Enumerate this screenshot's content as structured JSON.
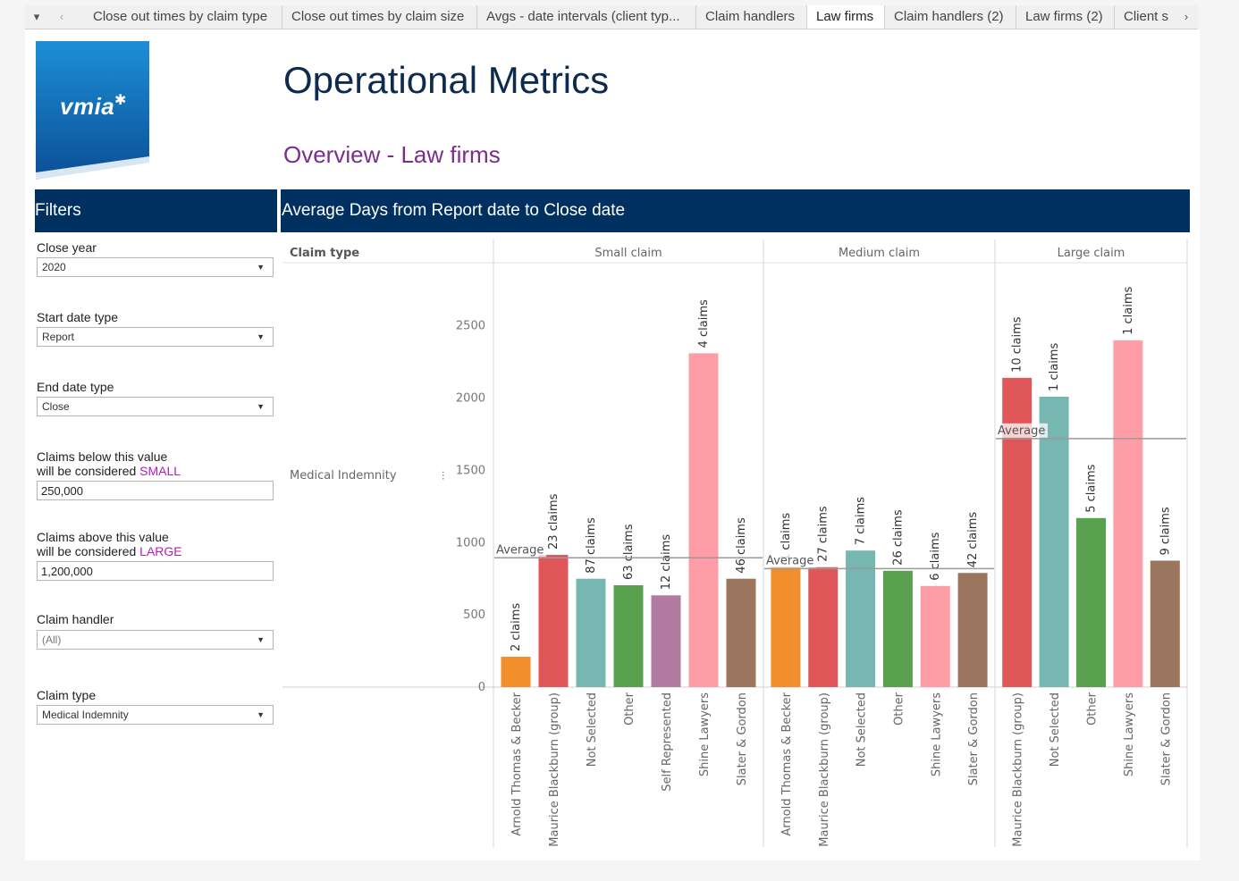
{
  "tabs": {
    "items": [
      "Close out times by claim type",
      "Close out times by claim size",
      "Avgs - date intervals (client typ...",
      "Claim handlers",
      "Law firms",
      "Claim handlers (2)",
      "Law firms (2)",
      "Client s"
    ],
    "active": "Law firms"
  },
  "header": {
    "logo": "vmia",
    "title": "Operational Metrics",
    "subtitle": "Overview - Law firms"
  },
  "filters": {
    "heading": "Filters",
    "close_year": {
      "label": "Close year",
      "value": "2020"
    },
    "start_date_type": {
      "label": "Start date type",
      "value": "Report"
    },
    "end_date_type": {
      "label": "End date type",
      "value": "Close"
    },
    "small": {
      "label_line1": "Claims below this value",
      "label_prefix": "will be considered ",
      "label_hl": "SMALL",
      "value": "250,000"
    },
    "large": {
      "label_line1": "Claims above this value",
      "label_prefix": "will be considered ",
      "label_hl": "LARGE",
      "value": "1,200,000"
    },
    "claim_handler": {
      "label": "Claim handler",
      "value": "(All)"
    },
    "claim_type": {
      "label": "Claim type",
      "value": "Medical Indemnity"
    }
  },
  "chart_title": "Average Days from Report date to Close date",
  "chart_data": {
    "type": "bar",
    "row_header": "Claim type",
    "row_label": "Medical Indemnity",
    "average_label": "Average",
    "ylim": [
      0,
      2900
    ],
    "yticks": [
      0,
      500,
      1000,
      1500,
      2000,
      2500
    ],
    "panels": [
      {
        "name": "Small claim",
        "average": 895,
        "bars": [
          {
            "firm": "Arnold Thomas & Becker",
            "value": 210,
            "label": "2 claims",
            "color": "#f28e2b"
          },
          {
            "firm": "Maurice Blackburn (group)",
            "value": 915,
            "label": "23 claims",
            "color": "#e15759"
          },
          {
            "firm": "Not Selected",
            "value": 750,
            "label": "87 claims",
            "color": "#76b7b2"
          },
          {
            "firm": "Other",
            "value": 705,
            "label": "63 claims",
            "color": "#59a14f"
          },
          {
            "firm": "Self Represented",
            "value": 635,
            "label": "12 claims",
            "color": "#b07aa1"
          },
          {
            "firm": "Shine Lawyers",
            "value": 2310,
            "label": "4 claims",
            "color": "#ff9da7"
          },
          {
            "firm": "Slater & Gordon",
            "value": 750,
            "label": "46 claims",
            "color": "#9c755f"
          }
        ]
      },
      {
        "name": "Medium claim",
        "average": 820,
        "bars": [
          {
            "firm": "Arnold Thomas & Becker",
            "value": 835,
            "label": "1 claims",
            "color": "#f28e2b"
          },
          {
            "firm": "Maurice Blackburn (group)",
            "value": 830,
            "label": "27 claims",
            "color": "#e15759"
          },
          {
            "firm": "Not Selected",
            "value": 945,
            "label": "7 claims",
            "color": "#76b7b2"
          },
          {
            "firm": "Other",
            "value": 805,
            "label": "26 claims",
            "color": "#59a14f"
          },
          {
            "firm": "Shine Lawyers",
            "value": 700,
            "label": "6 claims",
            "color": "#ff9da7"
          },
          {
            "firm": "Slater & Gordon",
            "value": 790,
            "label": "42 claims",
            "color": "#9c755f"
          }
        ]
      },
      {
        "name": "Large claim",
        "average": 1720,
        "bars": [
          {
            "firm": "Maurice Blackburn (group)",
            "value": 2140,
            "label": "10 claims",
            "color": "#e15759"
          },
          {
            "firm": "Not Selected",
            "value": 2010,
            "label": "1 claims",
            "color": "#76b7b2"
          },
          {
            "firm": "Other",
            "value": 1170,
            "label": "5 claims",
            "color": "#59a14f"
          },
          {
            "firm": "Shine Lawyers",
            "value": 2400,
            "label": "1 claims",
            "color": "#ff9da7"
          },
          {
            "firm": "Slater & Gordon",
            "value": 875,
            "label": "9 claims",
            "color": "#9c755f"
          }
        ]
      }
    ]
  }
}
